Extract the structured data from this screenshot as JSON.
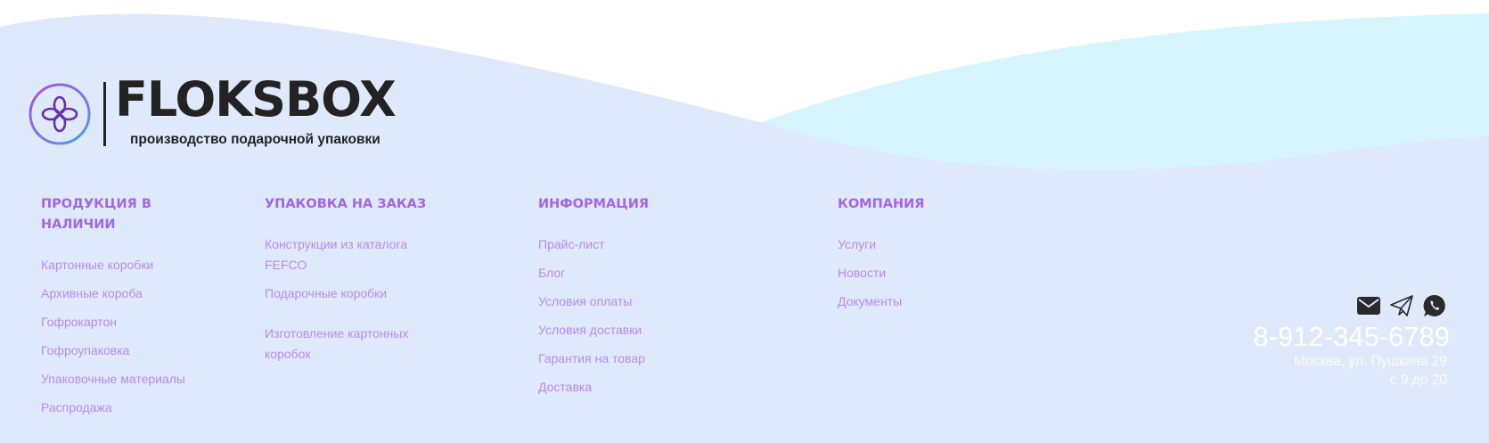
{
  "brand": {
    "name": "FLOKSBOX",
    "tagline": "производство подарочной упаковки"
  },
  "colors": {
    "footer_bg": "#dfe9fc",
    "wave_light": "#d7f5fd",
    "heading": "#a266e6",
    "link": "#b07be8",
    "contact_text": "#ffffff"
  },
  "footer": {
    "columns": [
      {
        "heading": "ПРОДУКЦИЯ В НАЛИЧИИ",
        "links": [
          "Картонные коробки",
          "Архивные короба",
          "Гофрокартон",
          "Гофроупаковка",
          "Упаковочные материалы",
          "Распродажа"
        ]
      },
      {
        "heading": "УПАКОВКА НА ЗАКАЗ",
        "links": [
          "Конструкции из каталога FEFCO",
          "Подарочные коробки",
          "Изготовление картонных коробок"
        ]
      },
      {
        "heading": "ИНФОРМАЦИЯ",
        "links": [
          "Прайс-лист",
          "Блог",
          "Условия оплаты",
          "Условия доставки",
          "Гарантия на товар",
          "Доставка"
        ]
      },
      {
        "heading": "КОМПАНИЯ",
        "links": [
          "Услуги",
          "Новости",
          "Документы"
        ]
      }
    ],
    "contacts": {
      "icons": [
        "mail-icon",
        "telegram-icon",
        "whatsapp-icon"
      ],
      "phone": "8-912-345-6789",
      "address": "Москва, ул. Пушкина 29",
      "hours": "с 9 до 20"
    }
  }
}
